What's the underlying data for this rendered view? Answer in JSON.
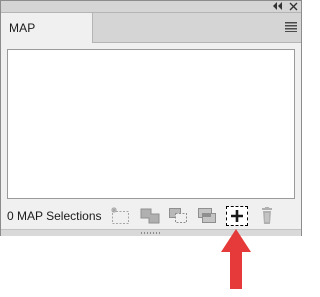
{
  "panel": {
    "tab_label": "MAP Selections",
    "selection_count": "0 MAP Selections"
  },
  "icons": {
    "collapse": "double-chevron-left-icon",
    "close": "close-icon",
    "panel_menu": "hamburger-menu-icon",
    "new_selection": "new-selection-icon",
    "combine_selections": "combine-selections-icon",
    "subtract_selections": "subtract-selections-icon",
    "intersect_selections": "intersect-selections-icon",
    "add_selection": "add-selection-icon",
    "delete": "trash-icon",
    "annotation": "red-arrow-up-icon"
  },
  "colors": {
    "panel_bg": "#f0f0f0",
    "titlebar_bg": "#d5d5d5",
    "disabled_icon": "#a6a6a6",
    "active_icon": "#1a1a1a",
    "annotation_arrow": "#e63a3a"
  }
}
